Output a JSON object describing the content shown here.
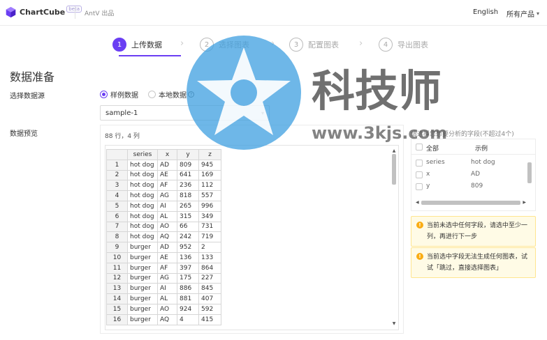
{
  "header": {
    "logo_text": "ChartCube",
    "beta_badge": "beta",
    "org": "AntV 出品",
    "language": "English",
    "all_products": "所有产品"
  },
  "steps": [
    {
      "num": "1",
      "label": "上传数据",
      "active": true
    },
    {
      "num": "2",
      "label": "选择图表",
      "active": false
    },
    {
      "num": "3",
      "label": "配置图表",
      "active": false
    },
    {
      "num": "4",
      "label": "导出图表",
      "active": false
    }
  ],
  "main": {
    "title": "数据准备",
    "source_label": "选择数据源",
    "source_options": [
      "样例数据",
      "本地数据"
    ],
    "selected_source": "样例数据",
    "sample_select_value": "sample-1",
    "preview_label": "数据预览",
    "row_count": "88 行，4 列"
  },
  "table": {
    "columns": [
      "series",
      "x",
      "y",
      "z"
    ],
    "rows": [
      [
        "1",
        "hot dog",
        "AD",
        "809",
        "945"
      ],
      [
        "2",
        "hot dog",
        "AE",
        "641",
        "169"
      ],
      [
        "3",
        "hot dog",
        "AF",
        "236",
        "112"
      ],
      [
        "4",
        "hot dog",
        "AG",
        "818",
        "557"
      ],
      [
        "5",
        "hot dog",
        "AI",
        "265",
        "996"
      ],
      [
        "6",
        "hot dog",
        "AL",
        "315",
        "349"
      ],
      [
        "7",
        "hot dog",
        "AO",
        "66",
        "731"
      ],
      [
        "8",
        "hot dog",
        "AQ",
        "242",
        "719"
      ],
      [
        "9",
        "burger",
        "AD",
        "952",
        "2"
      ],
      [
        "10",
        "burger",
        "AE",
        "136",
        "133"
      ],
      [
        "11",
        "burger",
        "AF",
        "397",
        "864"
      ],
      [
        "12",
        "burger",
        "AG",
        "175",
        "227"
      ],
      [
        "13",
        "burger",
        "AI",
        "886",
        "845"
      ],
      [
        "14",
        "burger",
        "AL",
        "881",
        "407"
      ],
      [
        "15",
        "burger",
        "AO",
        "924",
        "592"
      ],
      [
        "16",
        "burger",
        "AQ",
        "4",
        "415"
      ]
    ]
  },
  "fields": {
    "hint": "请选择您想要分析的字段(不超过4个)",
    "header_all": "全部",
    "header_example": "示例",
    "items": [
      {
        "name": "series",
        "example": "hot dog"
      },
      {
        "name": "x",
        "example": "AD"
      },
      {
        "name": "y",
        "example": "809"
      }
    ]
  },
  "warnings": [
    "当前未选中任何字段，请选中至少一列，再进行下一步",
    "当前选中字段无法生成任何图表，试试「跳过，直接选择图表」"
  ],
  "watermark": {
    "title": "科技师",
    "url": "www.3kjs.com"
  },
  "colors": {
    "accent": "#6a3ef3",
    "warning_bg": "#fffbe6",
    "warning_border": "#ffe58f",
    "warning_icon": "#faad14",
    "watermark_blue": "#3d9fe0"
  }
}
